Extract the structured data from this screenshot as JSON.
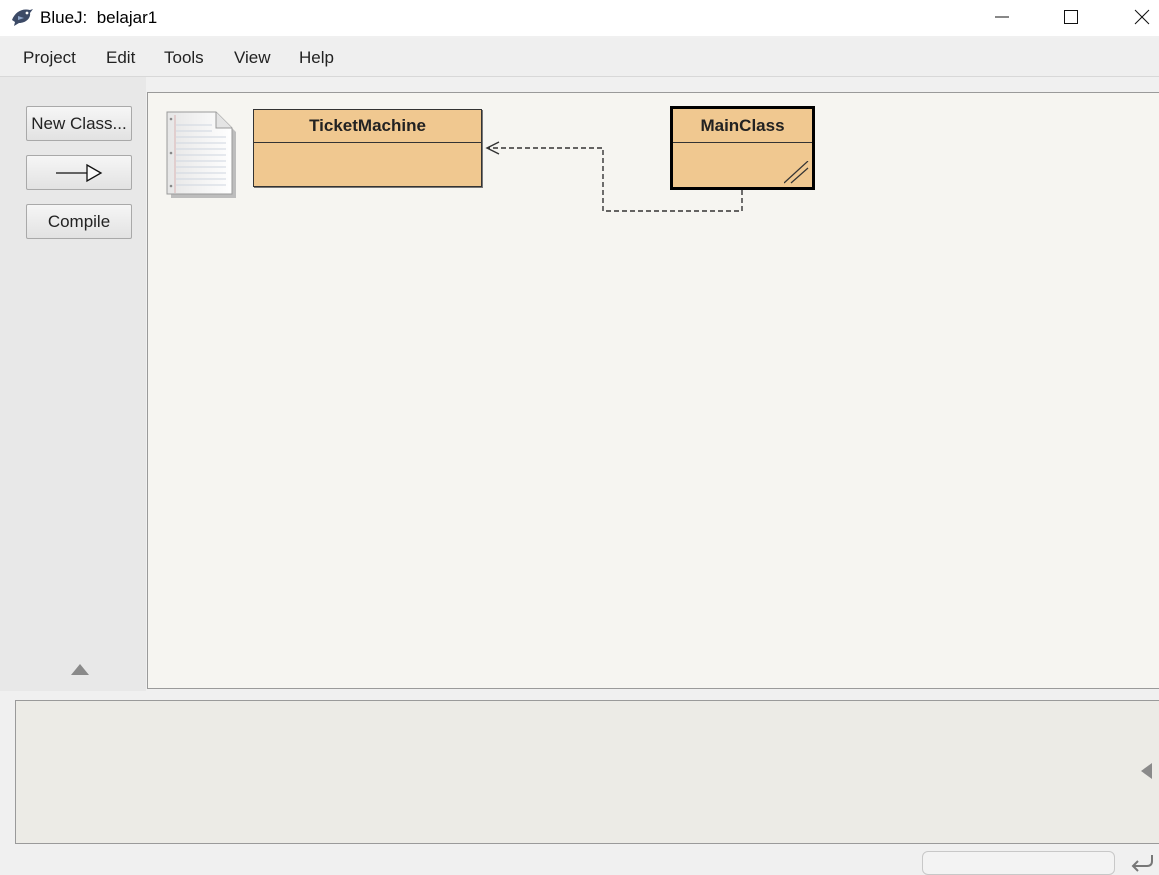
{
  "window": {
    "title": "BlueJ:  belajar1",
    "icon": "bluej-bird-icon",
    "controls": [
      "minimize-icon",
      "maximize-icon",
      "close-icon"
    ]
  },
  "menu": {
    "items": [
      "Project",
      "Edit",
      "Tools",
      "View",
      "Help"
    ]
  },
  "toolbar": {
    "new_class_label": "New Class...",
    "inheritance_arrow_icon": "inheritance-arrow-icon",
    "compile_label": "Compile"
  },
  "diagram": {
    "readme_icon": "readme-document-icon",
    "classes": [
      {
        "name": "TicketMachine",
        "compiled": true
      },
      {
        "name": "MainClass",
        "compiled": false,
        "selected": true
      }
    ],
    "dependency": {
      "from": "MainClass",
      "to": "TicketMachine",
      "style": "dashed"
    }
  },
  "colors": {
    "class_fill": "#f0c890",
    "canvas_bg": "#f6f5f1",
    "bench_bg": "#ecebe6"
  }
}
